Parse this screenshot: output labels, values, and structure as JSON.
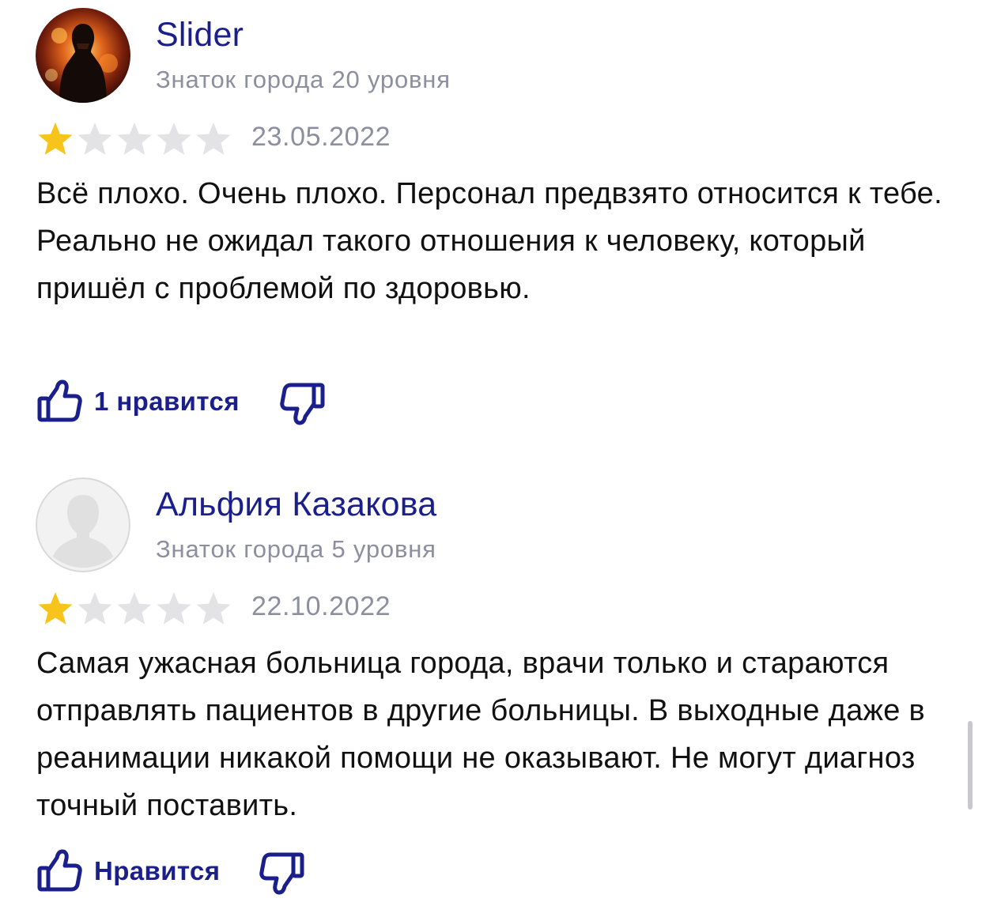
{
  "colors": {
    "accent": "#1b1f8c",
    "secondary_text": "#8c8f9e",
    "star_filled": "#f7c41c",
    "star_empty": "#e3e3e6"
  },
  "reviews": [
    {
      "author": "Slider",
      "level": "Знаток города 20 уровня",
      "rating": 1,
      "rating_max": 5,
      "date": "23.05.2022",
      "text": "Всё плохо. Очень плохо. Персонал предвзято относится к тебе. Реально не ожидал такого отношения к человеку, который пришёл с проблемой по здоровью.",
      "like_label": "1 нравится",
      "avatar_icon": "avatar-photo-icon"
    },
    {
      "author": "Альфия Казакова",
      "level": "Знаток города 5 уровня",
      "rating": 1,
      "rating_max": 5,
      "date": "22.10.2022",
      "text": "Самая ужасная больница города, врачи только и стараются отправлять пациентов в другие больницы. В выходные даже в реанимации никакой помощи не оказывают. Не могут диагноз точный поставить.",
      "like_label": "Нравится",
      "avatar_icon": "default-avatar-icon"
    }
  ],
  "icons": {
    "like": "thumbs-up-icon",
    "dislike": "thumbs-down-icon",
    "star": "star-icon"
  }
}
